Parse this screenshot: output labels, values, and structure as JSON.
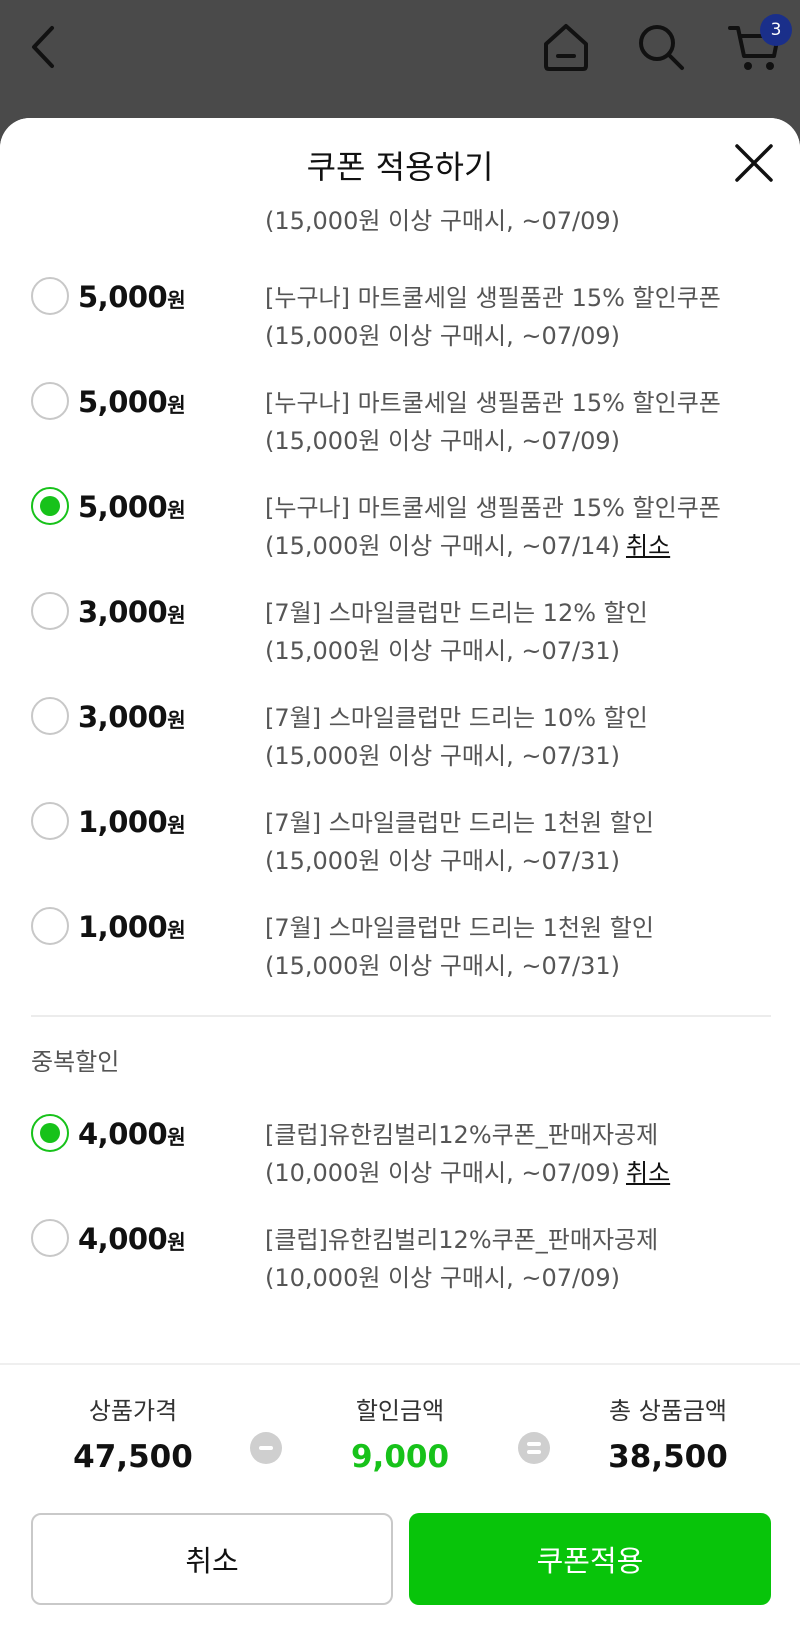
{
  "topbar": {
    "cart_count": "3"
  },
  "sheet": {
    "title": "쿠폰 적용하기"
  },
  "coupons_top": [
    {
      "amount": "",
      "unit": "",
      "line1": "",
      "line2": "(15,000원 이상 구매시, ~07/09)",
      "selected": false,
      "cancel": ""
    },
    {
      "amount": "5,000",
      "unit": "원",
      "line1": "[누구나] 마트쿨세일 생필품관 15% 할인쿠폰",
      "line2": "(15,000원 이상 구매시, ~07/09)",
      "selected": false,
      "cancel": ""
    },
    {
      "amount": "5,000",
      "unit": "원",
      "line1": "[누구나] 마트쿨세일 생필품관 15% 할인쿠폰",
      "line2": "(15,000원 이상 구매시, ~07/09)",
      "selected": false,
      "cancel": ""
    },
    {
      "amount": "5,000",
      "unit": "원",
      "line1": "[누구나] 마트쿨세일 생필품관 15% 할인쿠폰",
      "line2": "(15,000원 이상 구매시, ~07/14)",
      "selected": true,
      "cancel": "취소"
    },
    {
      "amount": "3,000",
      "unit": "원",
      "line1": "[7월] 스마일클럽만 드리는 12% 할인",
      "line2": "(15,000원 이상 구매시, ~07/31)",
      "selected": false,
      "cancel": ""
    },
    {
      "amount": "3,000",
      "unit": "원",
      "line1": "[7월] 스마일클럽만 드리는 10% 할인",
      "line2": "(15,000원 이상 구매시, ~07/31)",
      "selected": false,
      "cancel": ""
    },
    {
      "amount": "1,000",
      "unit": "원",
      "line1": "[7월] 스마일클럽만 드리는 1천원 할인",
      "line2": "(15,000원 이상 구매시, ~07/31)",
      "selected": false,
      "cancel": ""
    },
    {
      "amount": "1,000",
      "unit": "원",
      "line1": "[7월] 스마일클럽만 드리는 1천원 할인",
      "line2": "(15,000원 이상 구매시, ~07/31)",
      "selected": false,
      "cancel": ""
    }
  ],
  "duplicate_section": {
    "title": "중복할인",
    "coupons": [
      {
        "amount": "4,000",
        "unit": "원",
        "line1": "[클럽]유한킴벌리12%쿠폰_판매자공제",
        "line2": "(10,000원 이상 구매시, ~07/09)",
        "selected": true,
        "cancel": "취소"
      },
      {
        "amount": "4,000",
        "unit": "원",
        "line1": "[클럽]유한킴벌리12%쿠폰_판매자공제",
        "line2": "(10,000원 이상 구매시, ~07/09)",
        "selected": false,
        "cancel": ""
      }
    ]
  },
  "summary": {
    "product_price_label": "상품가격",
    "product_price": "47,500",
    "discount_label": "할인금액",
    "discount": "9,000",
    "total_label": "총 상품금액",
    "total": "38,500"
  },
  "buttons": {
    "cancel": "취소",
    "apply": "쿠폰적용"
  },
  "colors": {
    "accent_green": "#08c40a",
    "badge_blue": "#1a2f8a",
    "topbar_bg": "#4a4a4a"
  }
}
